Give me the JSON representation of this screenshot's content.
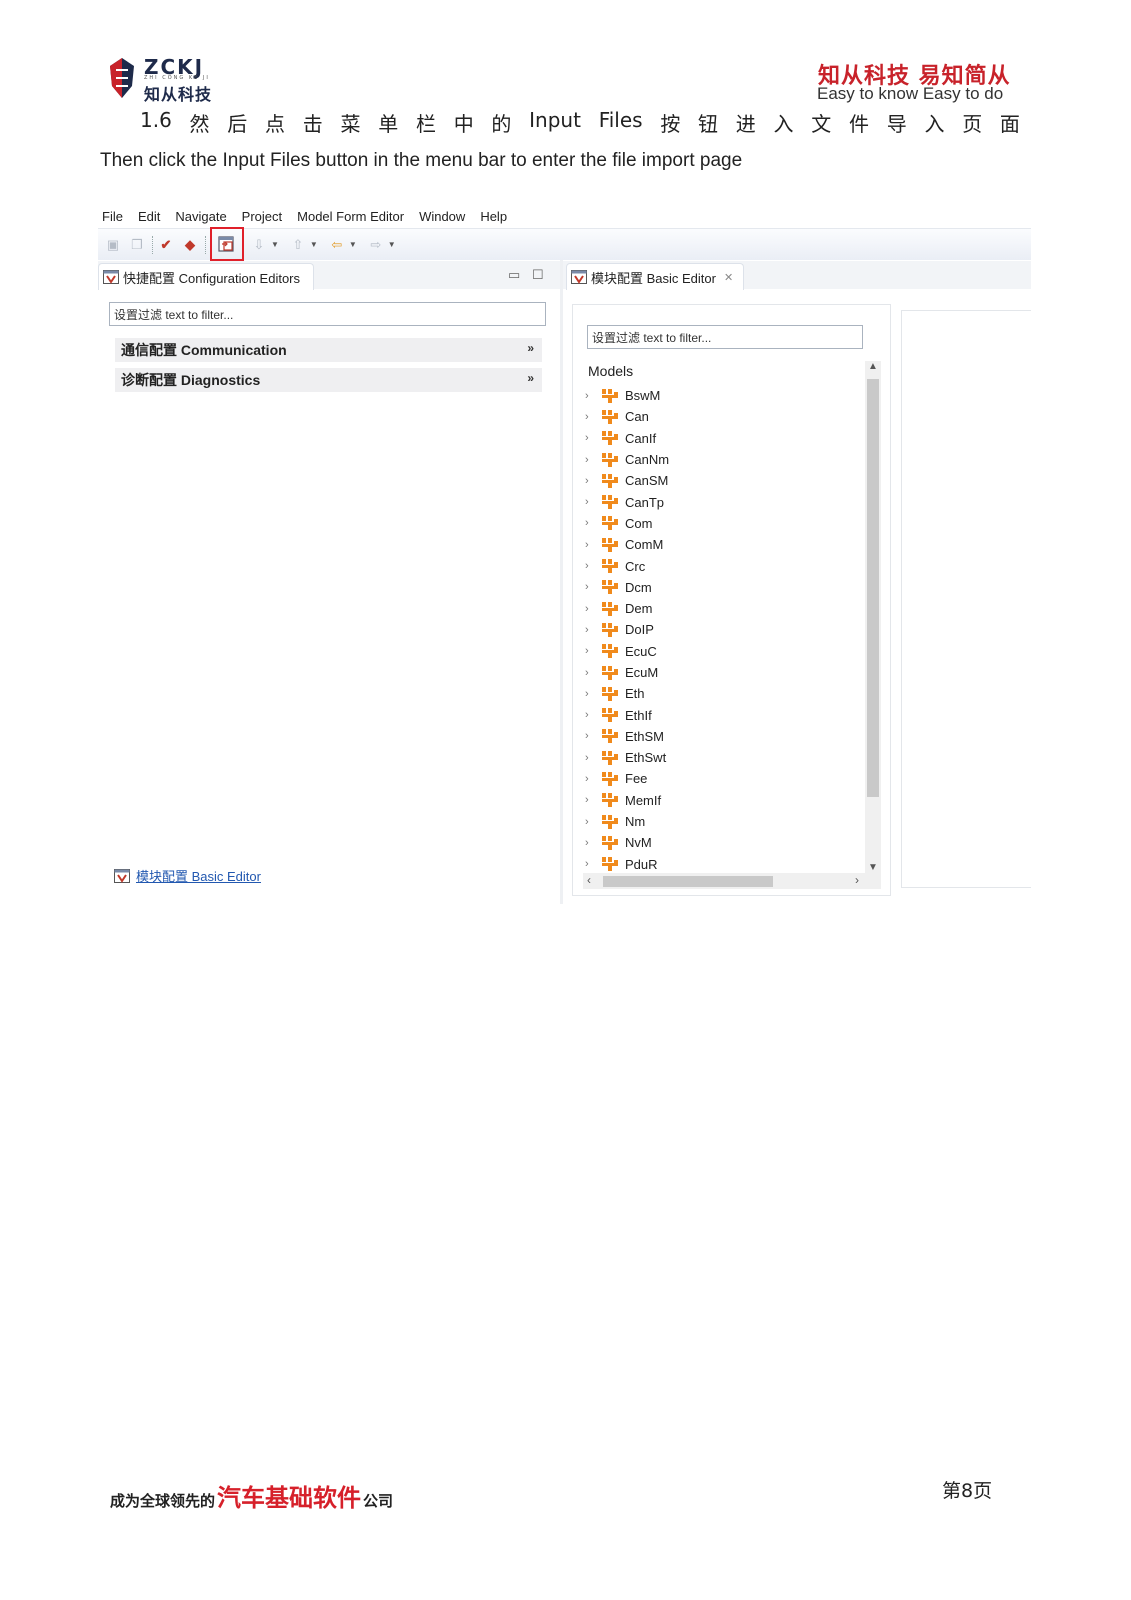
{
  "header": {
    "logo_en": "ZCKJ",
    "logo_sub": "ZHI CONG KE JI",
    "logo_cn": "知从科技",
    "slogan_cn": "知从科技 易知简从",
    "slogan_en": "Easy to know Easy to do"
  },
  "instruction": {
    "cn_tokens": [
      "1.6",
      "然",
      "后",
      "点",
      "击",
      "菜",
      "单",
      "栏",
      "中",
      "的",
      "Input",
      "Files",
      "按",
      "钮",
      "进",
      "入",
      "文",
      "件",
      "导",
      "入",
      "页",
      "面"
    ],
    "en": "Then click the Input Files button in the menu bar to enter the file import page"
  },
  "screenshot": {
    "menu": [
      "File",
      "Edit",
      "Navigate",
      "Project",
      "Model Form Editor",
      "Window",
      "Help"
    ],
    "left_tab_label": "快捷配置 Configuration Editors",
    "left_filter_placeholder": "设置过滤 text to filter...",
    "sections": [
      "通信配置 Communication",
      "诊断配置 Diagnostics"
    ],
    "basic_editor_link": "模块配置 Basic Editor",
    "right_tab_label": "模块配置 Basic Editor",
    "right_filter_placeholder": "设置过滤 text to filter...",
    "models_label": "Models",
    "models": [
      "BswM",
      "Can",
      "CanIf",
      "CanNm",
      "CanSM",
      "CanTp",
      "Com",
      "ComM",
      "Crc",
      "Dcm",
      "Dem",
      "DoIP",
      "EcuC",
      "EcuM",
      "Eth",
      "EthIf",
      "EthSM",
      "EthSwt",
      "Fee",
      "MemIf",
      "Nm",
      "NvM",
      "PduR"
    ],
    "colors": {
      "highlight_box": "#e0202a",
      "model_icon": "#f08a1c",
      "link": "#2258b0"
    }
  },
  "footer": {
    "tagline_prefix": "成为全球领先的",
    "tagline_highlight": "汽车基础软件",
    "tagline_suffix": "公司",
    "page": "第8页"
  }
}
